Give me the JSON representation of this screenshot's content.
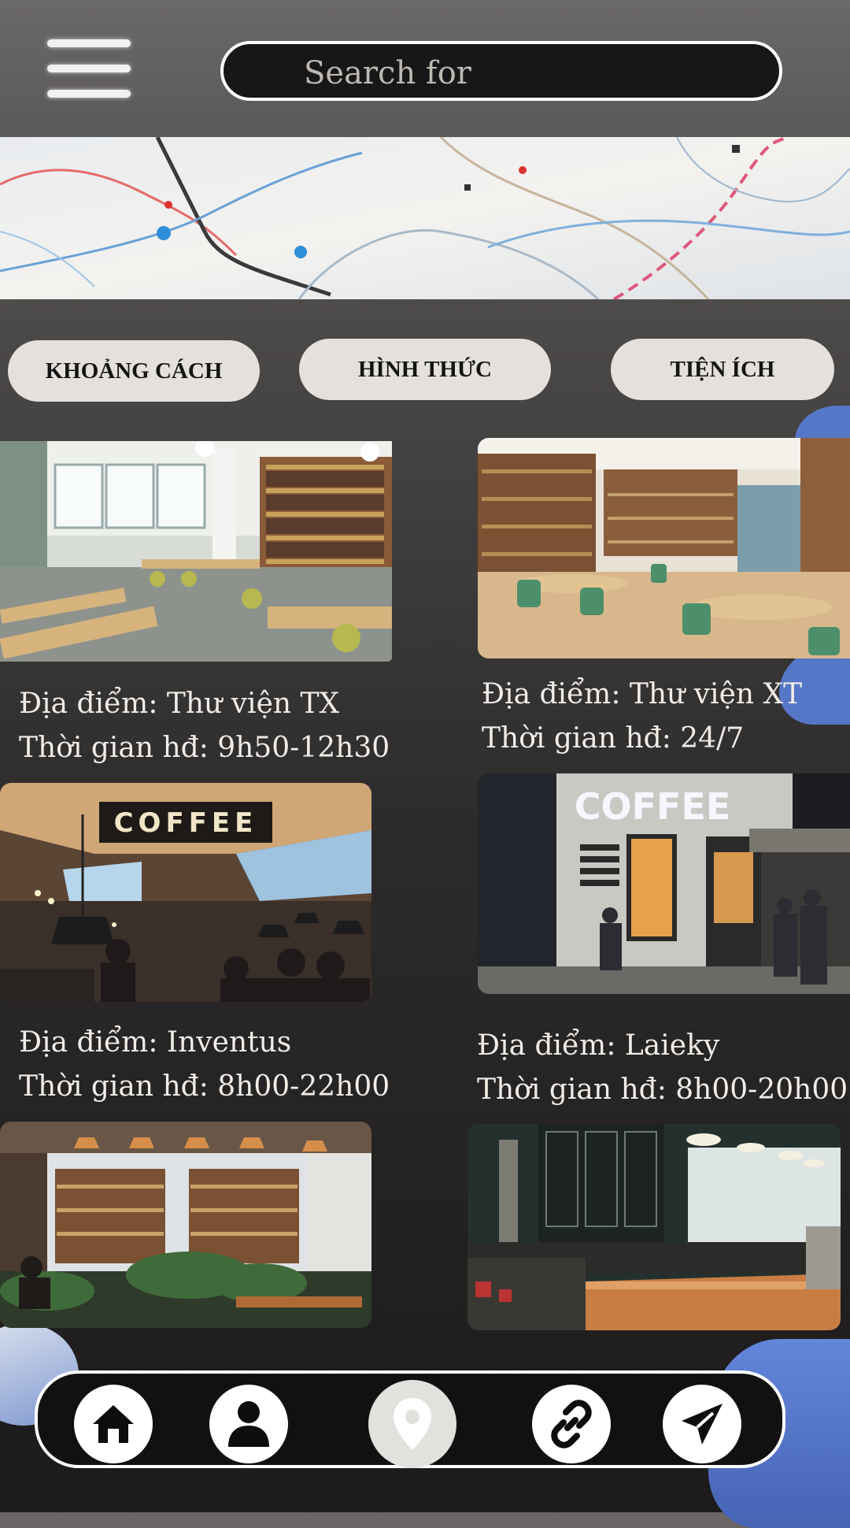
{
  "header": {
    "menu_icon": "hamburger-menu-icon",
    "search_placeholder": "Search for"
  },
  "filters": [
    {
      "label": "KHOẢNG CÁCH"
    },
    {
      "label": "HÌNH THỨC"
    },
    {
      "label": "TIỆN ÍCH"
    }
  ],
  "places": [
    {
      "location": "Địa điểm: Thư viện TX",
      "hours": "Thời gian hđ: 9h50-12h30",
      "image": "library-reading-room-photo"
    },
    {
      "location": "Địa điểm: Thư viện XT",
      "hours": "Thời gian hđ: 24/7",
      "image": "library-cafe-photo"
    },
    {
      "location": "Địa điểm: Inventus",
      "hours": "Thời gian hđ: 8h00-22h00",
      "image": "coffee-shop-interior-photo"
    },
    {
      "location": "Địa điểm: Laieky",
      "hours": "Thời gian hđ: 8h00-20h00",
      "image": "coffee-shop-storefront-photo"
    },
    {
      "image": "bookstore-cafe-photo"
    },
    {
      "image": "coffee-bar-counter-photo"
    }
  ],
  "photo_signs": {
    "coffee_sign_1": "COFFEE",
    "coffee_sign_2": "COFFEE"
  },
  "nav": [
    {
      "icon": "home-icon"
    },
    {
      "icon": "user-icon"
    },
    {
      "icon": "location-pin-icon",
      "active": true
    },
    {
      "icon": "link-icon"
    },
    {
      "icon": "send-icon"
    }
  ],
  "colors": {
    "accent_blue": "#5677c8",
    "pill_bg": "#e4e1dc",
    "nav_bg": "#121111"
  }
}
